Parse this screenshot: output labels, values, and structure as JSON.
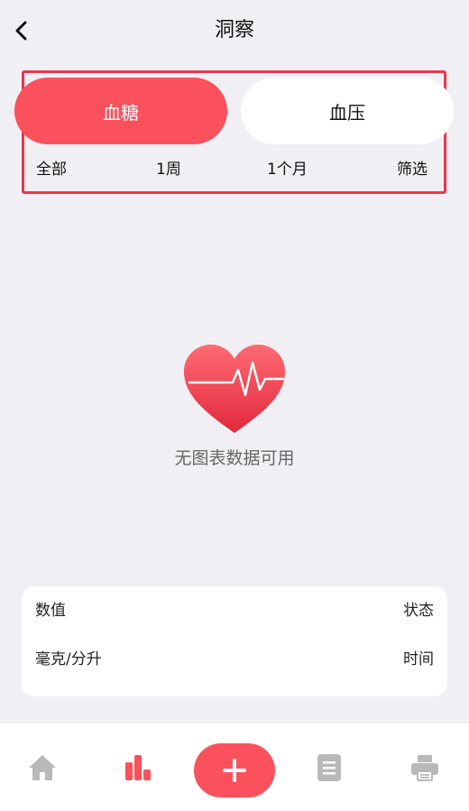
{
  "header": {
    "title": "洞察"
  },
  "segments": {
    "active": "血糖",
    "inactive": "血压"
  },
  "ranges": [
    "全部",
    "1周",
    "1个月",
    "筛选"
  ],
  "empty": {
    "message": "无图表数据可用"
  },
  "card": {
    "value_label": "数值",
    "status_label": "状态",
    "unit_label": "毫克/分升",
    "time_label": "时间"
  },
  "colors": {
    "accent": "#fa515d",
    "highlight_border": "#e8384a",
    "inactive_icon": "#b9b9b9"
  },
  "tabbar": {
    "icons": [
      "home-icon",
      "bar-chart-icon",
      "plus-icon",
      "document-icon",
      "printer-icon"
    ],
    "active_index": 1
  }
}
